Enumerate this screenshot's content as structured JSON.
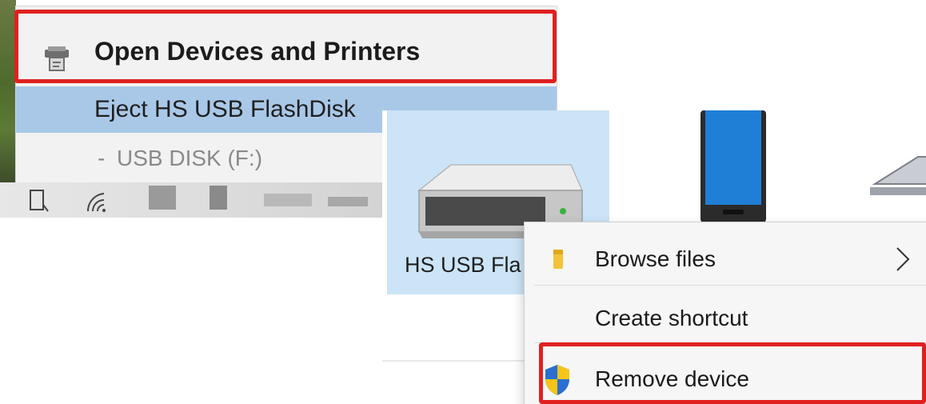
{
  "tray_menu": {
    "open_devices_label": "Open Devices and Printers",
    "eject_label": "Eject HS USB FlashDisk",
    "disk_dash": "-",
    "disk_label": "USB DISK (F:)",
    "highlight_color": "#a9c8e8",
    "callout_color": "#e02020"
  },
  "devices": {
    "selected_device_name": "HS USB Fla",
    "items": [
      {
        "icon": "usb-drive-icon"
      },
      {
        "icon": "phone-icon"
      },
      {
        "icon": "laptop-icon"
      }
    ]
  },
  "context_menu": {
    "browse_files_label": "Browse files",
    "create_shortcut_label": "Create shortcut",
    "remove_device_label": "Remove device"
  }
}
